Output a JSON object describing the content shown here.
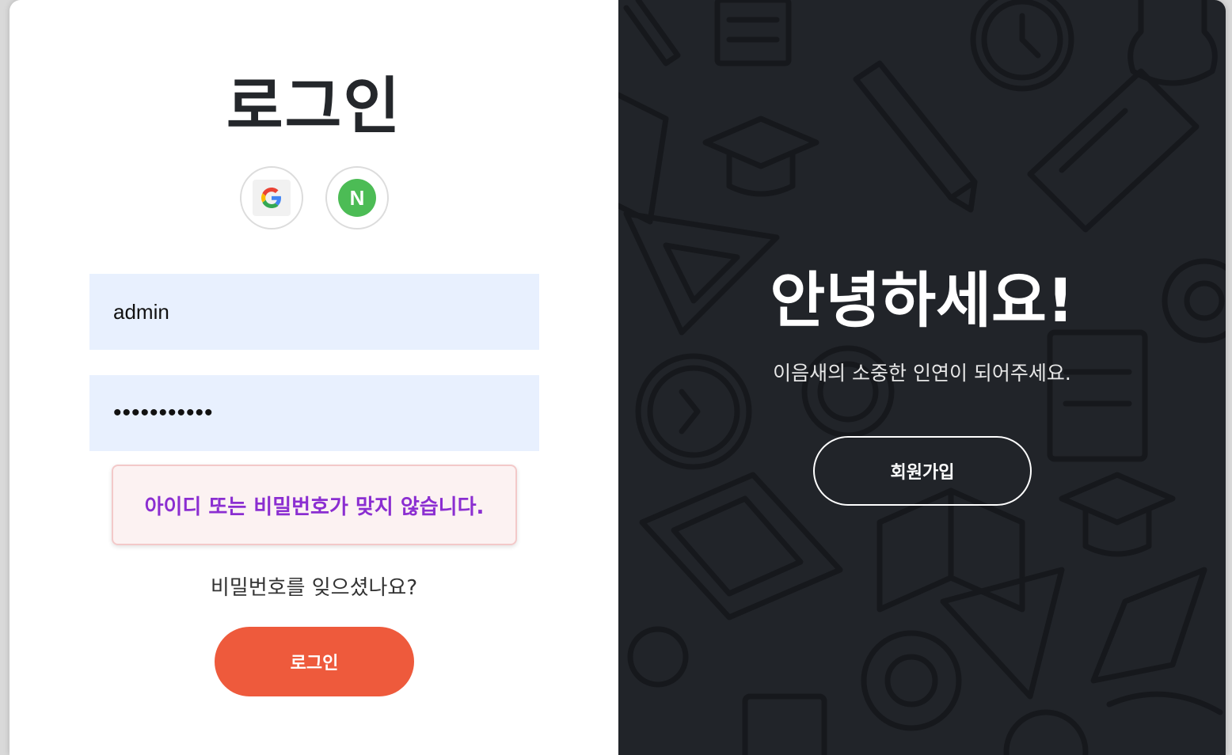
{
  "login_panel": {
    "title": "로그인",
    "social": [
      {
        "name": "google",
        "letter": "G"
      },
      {
        "name": "naver",
        "letter": "N"
      }
    ],
    "username_value": "admin",
    "password_value": "•••••••••••",
    "error_message": "아이디 또는 비밀번호가 맞지 않습니다.",
    "forgot_password": "비밀번호를 잊으셨나요?",
    "login_button": "로그인"
  },
  "welcome_panel": {
    "heading": "안녕하세요!",
    "subtext": "이음새의 소중한 인연이 되어주세요.",
    "signup_button": "회원가입"
  },
  "colors": {
    "primary_button": "#ee5a3c",
    "dark_panel": "#212429",
    "input_bg": "#e8f0fe",
    "error_text": "#8b2ed1",
    "naver_green": "#4cbc55"
  }
}
